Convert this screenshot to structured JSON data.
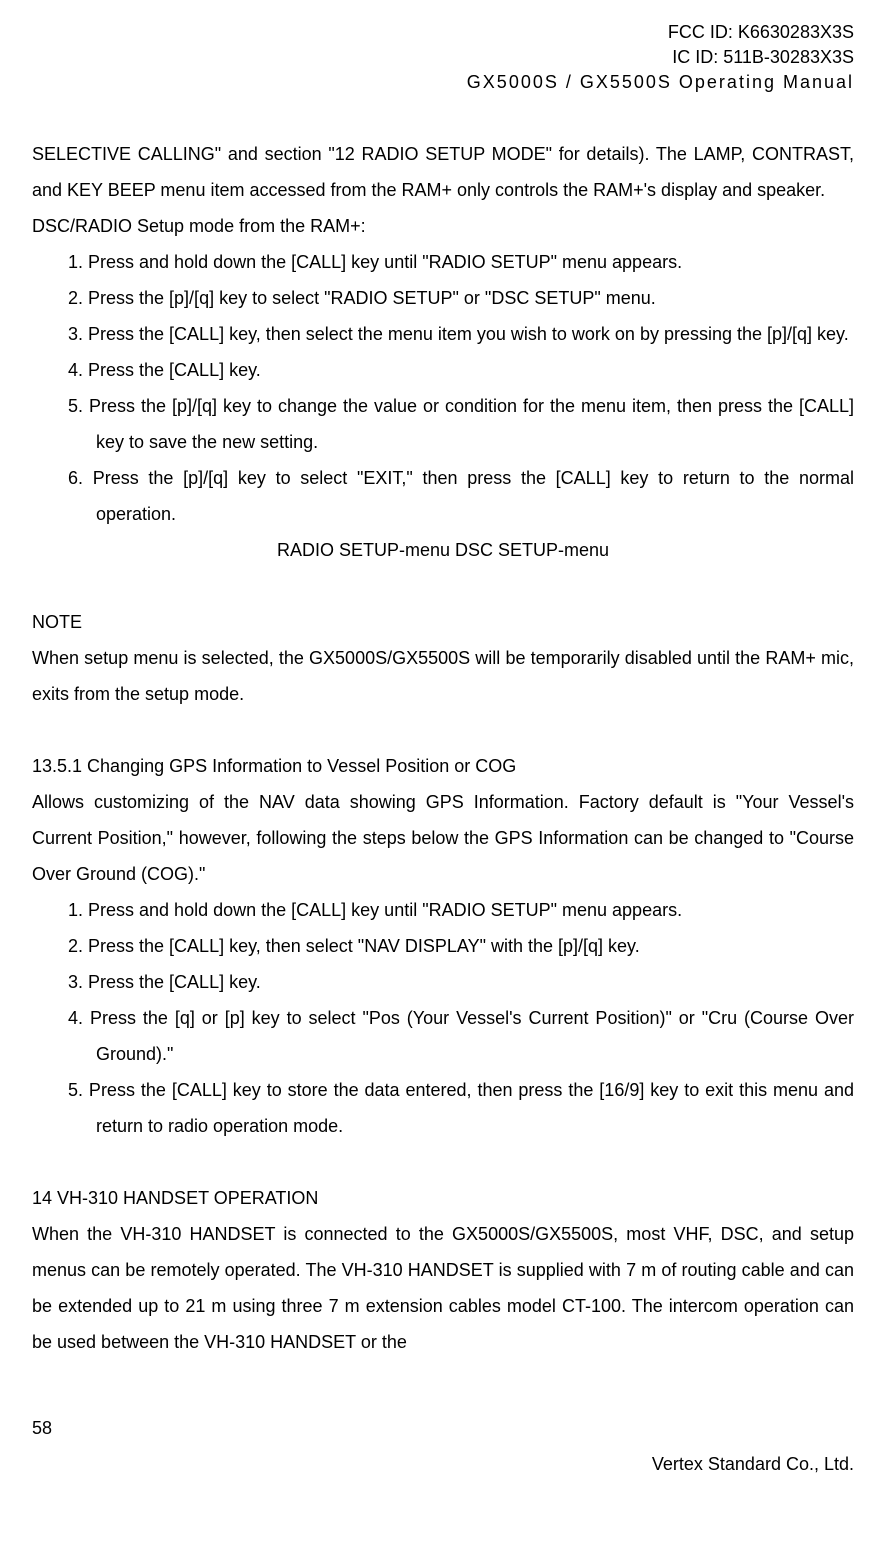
{
  "header": {
    "fcc_id": "FCC ID: K6630283X3S",
    "ic_id": "IC ID: 511B-30283X3S",
    "title": "GX5000S / GX5500S  Operating Manual"
  },
  "intro": {
    "para1": "SELECTIVE CALLING\" and section \"12 RADIO SETUP MODE\" for details). The LAMP, CONTRAST, and KEY BEEP menu item accessed from the RAM+ only controls the RAM+'s display and speaker.",
    "para2": "DSC/RADIO Setup mode from the RAM+:"
  },
  "list1": {
    "i1": "1.  Press and hold down the [CALL] key until \"RADIO SETUP\" menu appears.",
    "i2": "2.  Press the [p]/[q] key to select \"RADIO SETUP\" or \"DSC SETUP\" menu.",
    "i3": "3.  Press the [CALL] key, then select the menu item you wish to work on by pressing the [p]/[q] key.",
    "i4": "4.  Press the [CALL] key.",
    "i5": "5.  Press the [p]/[q] key to change the value or condition for the menu item, then press the [CALL] key to save the new setting.",
    "i6": "6.  Press the [p]/[q] key to select \"EXIT,\" then press the [CALL] key to return to the normal operation."
  },
  "menu_labels": "RADIO SETUP-menu        DSC SETUP-menu",
  "note": {
    "heading": "NOTE",
    "text": "When setup menu is selected, the GX5000S/GX5500S will be temporarily disabled until the RAM+ mic, exits from the setup mode."
  },
  "sec1351": {
    "heading": "13.5.1 Changing GPS Information to Vessel Position or COG",
    "para": "Allows customizing of the NAV data showing GPS Information. Factory default is \"Your Vessel's Current Position,\" however, following the steps below the GPS Information can be changed to \"Course Over Ground (COG).\""
  },
  "list2": {
    "i1": "1.  Press and hold down the [CALL] key until \"RADIO SETUP\" menu appears.",
    "i2": "2.  Press the [CALL] key, then select \"NAV DISPLAY\" with the [p]/[q] key.",
    "i3": "3.  Press the [CALL] key.",
    "i4": "4.  Press the [q] or [p] key to select \"Pos (Your Vessel's Current Position)\" or \"Cru (Course Over Ground).\"",
    "i5": "5.  Press the [CALL] key to store the data entered, then press the [16/9] key to exit this menu and return to radio operation mode."
  },
  "sec14": {
    "heading": "14 VH-310 HANDSET OPERATION",
    "para": "When the VH-310 HANDSET is connected to the GX5000S/GX5500S, most VHF, DSC, and setup menus can be remotely operated. The VH-310 HANDSET is supplied with 7 m of routing cable and can be extended up to 21 m using three 7 m extension cables model CT-100. The intercom operation can be used between the VH-310 HANDSET or the"
  },
  "footer": {
    "page": "58",
    "company": "Vertex Standard Co., Ltd."
  }
}
